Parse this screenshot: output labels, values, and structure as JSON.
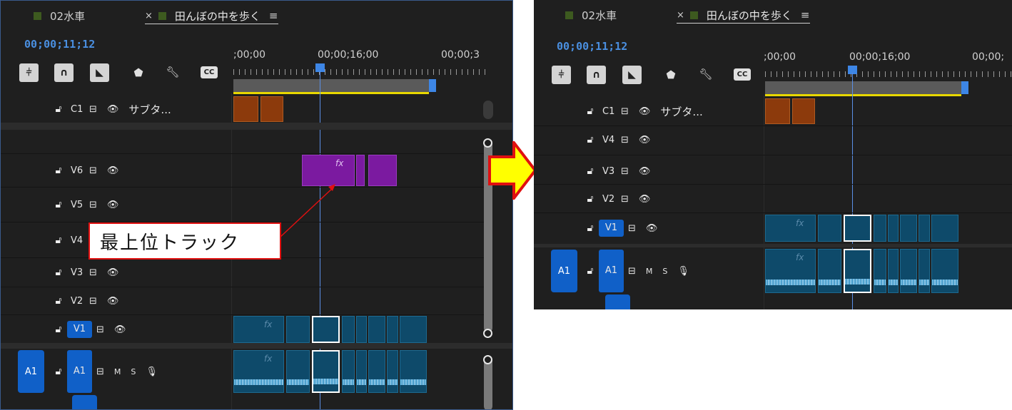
{
  "tabs": {
    "tab1": "02水車",
    "tab2": "田んぼの中を歩く",
    "close": "×",
    "menu": "≡"
  },
  "timecode": "00;00;11;12",
  "ruler": {
    "t0": ";00;00",
    "t1": "00;00;16;00",
    "t2_left": "00;00;3",
    "t2_right": "00;00;"
  },
  "tools": {
    "snap_icon": "nest-sequence-icon",
    "cc": "CC",
    "marker": "marker-icon",
    "wrench": "wrench-icon"
  },
  "tracks_left": {
    "c1": {
      "name": "C1",
      "label": "サブタ..."
    },
    "v6": "V6",
    "v5": "V5",
    "v4": "V4",
    "v3": "V3",
    "v2": "V2",
    "v1": "V1",
    "a1_target": "A1",
    "a1": "A1",
    "m": "M",
    "s": "S"
  },
  "tracks_right": {
    "c1": {
      "name": "C1",
      "label": "サブタ..."
    },
    "v4": "V4",
    "v3": "V3",
    "v2": "V2",
    "v1": "V1",
    "a1_target": "A1",
    "a1": "A1",
    "m": "M",
    "s": "S"
  },
  "callout": "最上位トラック",
  "clip_fx": "fx",
  "colors": {
    "accent": "#3d86e6",
    "callout_border": "#e01010",
    "arrow_fill": "#ffff00",
    "arrow_border": "#e01010"
  }
}
